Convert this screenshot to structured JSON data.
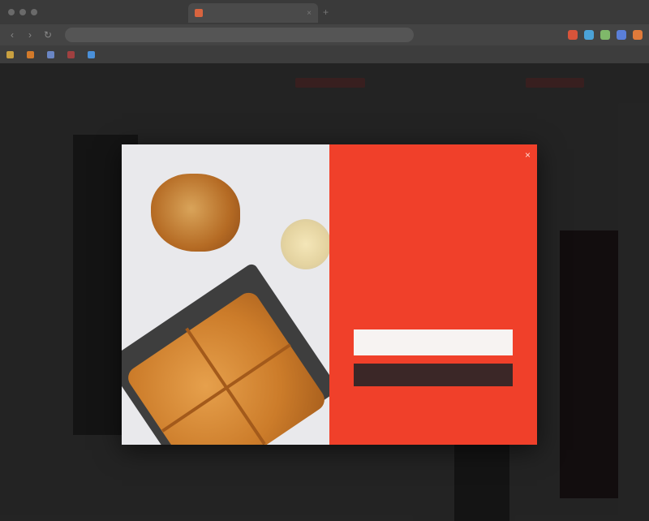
{
  "browser": {
    "tab_title": "",
    "tab_close": "×",
    "tab_add": "+",
    "url": "",
    "nav": {
      "back": "‹",
      "forward": "›",
      "reload": "↻"
    },
    "bookmarks": [
      {
        "label": "",
        "color": "#c9a040"
      },
      {
        "label": "",
        "color": "#d27a2a"
      },
      {
        "label": "",
        "color": "#6a86c4"
      },
      {
        "label": "",
        "color": "#a04040"
      },
      {
        "label": "",
        "color": "#4a90d9"
      }
    ],
    "extension_colors": [
      "#d8543a",
      "#4ba3d9",
      "#7fb86a",
      "#5a7fd9",
      "#e07a3a"
    ]
  },
  "modal": {
    "eyebrow": "",
    "headline": "",
    "email_placeholder": "",
    "submit_label": "",
    "close": "×"
  },
  "colors": {
    "form_bg": "#f0402a",
    "button_bg": "#3b2727",
    "backdrop": "#2f2f2f"
  }
}
